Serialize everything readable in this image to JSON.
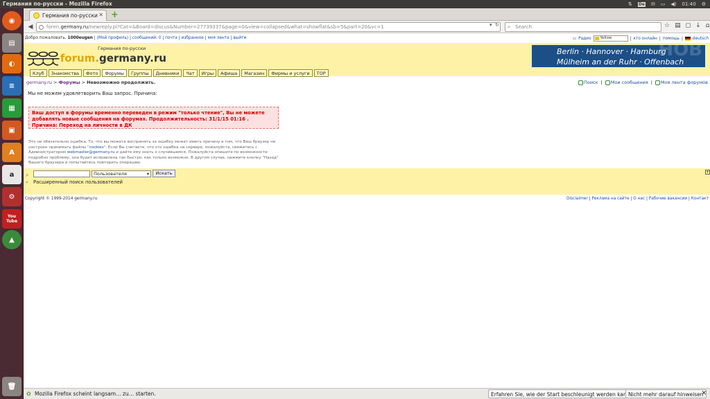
{
  "os": {
    "window_title": "Германия по-русски - Mozilla Firefox",
    "keyboard_layout": "De",
    "clock": "01:40"
  },
  "launcher": {
    "items": [
      "dash-icon",
      "files-icon",
      "firefox-icon",
      "writer-icon",
      "calc-icon",
      "impress-icon",
      "software-center-icon",
      "amazon-icon",
      "settings-icon",
      "youtube-icon",
      "update-icon",
      "trash-icon"
    ],
    "youtube_label": "You\nTube"
  },
  "browser": {
    "tab_title": "Германия по-русски",
    "url_prefix": "foren.",
    "url_host": "germany.ru",
    "url_path": "/newreply.pl?Cat=&Board=discus&Number=27739337&page=0&view=collapsed&what=showflat&sb=5&part=20&vc=1",
    "search_placeholder": "Search"
  },
  "userbar": {
    "welcome": "Добро пожаловать,",
    "username": "1000eugen",
    "profile": "(Мой профиль)",
    "messages": "сообщений: 0",
    "mail": "почта",
    "favorites": "избранное",
    "my_feed": "моя лента",
    "logout": "выйти",
    "radio": "Радио",
    "color_value": "Yellow",
    "online": "кто онлайн",
    "help": "помощь",
    "language": "deutsch"
  },
  "header": {
    "logo_prefix": "forum.",
    "logo_name": "germany.ru",
    "subtitle": "Германия по-русски",
    "banner_line1": "Berlin  ·  Hannover  ·  Hamburg",
    "banner_line2": "Mülheim an der Ruhr  ·  Offenbach",
    "banner_bg": "HOB",
    "menu": [
      "Клуб",
      "Знакомства",
      "Фото",
      "Форумы",
      "Группы",
      "Дневники",
      "Чат",
      "Игры",
      "Афиша",
      "Магазин",
      "Фирмы и услуги",
      "TOP"
    ]
  },
  "breadcrumb": {
    "home": "germany.ru",
    "sep": " > ",
    "forums": "Форумы",
    "current": "Невозможно продолжить."
  },
  "toplinks": {
    "search": "Поиск",
    "my_messages": "Мои сообщения",
    "my_feed": "Моя лента форумов"
  },
  "content": {
    "intro": "Мы не можем удовлетворить Ваш запрос. Причина:",
    "error": "Ваш доступ в форумы временно переведен в режим \"только чтение\", Вы не можете добавлять новые сообщения на форумах. Продолжительность: 31/1/15 01:16 . Причина: Переход на личности в ДК",
    "note_1": "Это не обязательно ошибка. То, что вы можете воспринять за ошибку может иметь причину в том, что Ваш браузер не настроен принимать файлы \"",
    "note_cookies": "cookies",
    "note_2": "\". Если Вы считаете, что это ошибка на сервере, пожалуйста, свяжитесь с Администратором ",
    "note_email": "webmaster@germany.ru",
    "note_3": " и дайте ему знать о случившемся. Пожалуйста опишите по возможности подробно проблему, она будет исправлена так быстро, как только возможно. В другом случае, нажмите кнопку \"Назад\" Вашего браузера и попытайтесь повторить операцию."
  },
  "search": {
    "select_value": "Пользователя",
    "button": "Искать",
    "advanced": "Расширенный поиск пользователей"
  },
  "footer": {
    "copyright": "Copyright © 1999-2014 germany.ru",
    "disclaimer": "Disclaimer",
    "ads": "Реклама на сайте",
    "about": "О нас",
    "jobs": "Рабочие вакансии",
    "contact": "Контакт"
  },
  "statusbar": {
    "message": "Mozilla Firefox scheint langsam… zu… starten.",
    "learn_more": "Erfahren Sie, wie der Start beschleunigt werden kann",
    "dismiss": "Nicht mehr darauf hinweisen"
  },
  "colors": {
    "header_bg": "#fef2a6",
    "error_text": "#cc0000",
    "launcher_bg": "#4a2a33"
  }
}
